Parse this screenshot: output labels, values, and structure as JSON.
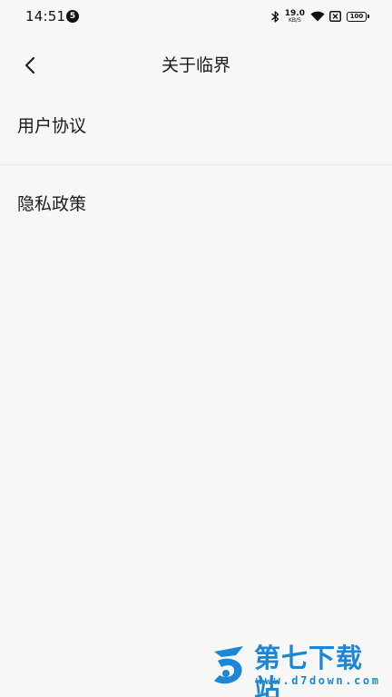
{
  "status_bar": {
    "time": "14:51",
    "notification_count": "5",
    "network_speed_value": "19.0",
    "network_speed_unit": "KB/S",
    "battery_level": "100"
  },
  "header": {
    "title": "关于临界"
  },
  "menu": {
    "items": [
      {
        "label": "用户协议"
      },
      {
        "label": "隐私政策"
      }
    ]
  },
  "watermark": {
    "title": "第七下载站",
    "url": "www.d7down.com",
    "color": "#1e86d6"
  },
  "icons": {
    "back": "chevron-left-icon",
    "bluetooth": "bluetooth-icon",
    "wifi": "wifi-icon",
    "sim": "sim-x-icon",
    "battery": "battery-icon"
  }
}
